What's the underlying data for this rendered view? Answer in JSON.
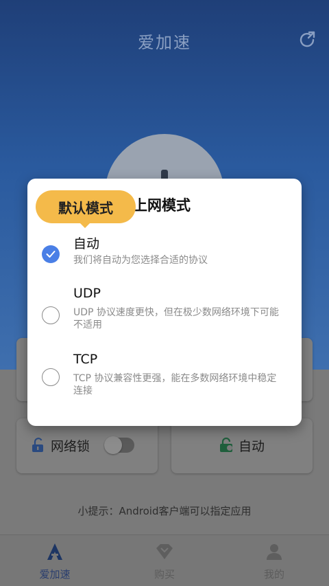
{
  "app": {
    "title": "爱加速"
  },
  "cards": {
    "lock_label": "网络锁",
    "mode_label": "自动"
  },
  "tip": "小提示：Android客户端可以指定应用",
  "tabs": [
    {
      "label": "爱加速",
      "icon": "accelerate-icon"
    },
    {
      "label": "购买",
      "icon": "diamond-icon"
    },
    {
      "label": "我的",
      "icon": "profile-icon"
    }
  ],
  "dialog": {
    "title": "上网模式",
    "tooltip": "默认模式",
    "options": [
      {
        "name": "自动",
        "desc": "我们将自动为您选择合适的协议",
        "selected": true
      },
      {
        "name": "UDP",
        "desc": "UDP 协议速度更快，但在极少数网络环境下可能不适用",
        "selected": false
      },
      {
        "name": "TCP",
        "desc": "TCP 协议兼容性更强，能在多数网络环境中稳定连接",
        "selected": false
      }
    ]
  },
  "colors": {
    "accent": "#4a7fe6",
    "tooltip": "#f4ba4a",
    "brand": "#2a5a9e"
  }
}
